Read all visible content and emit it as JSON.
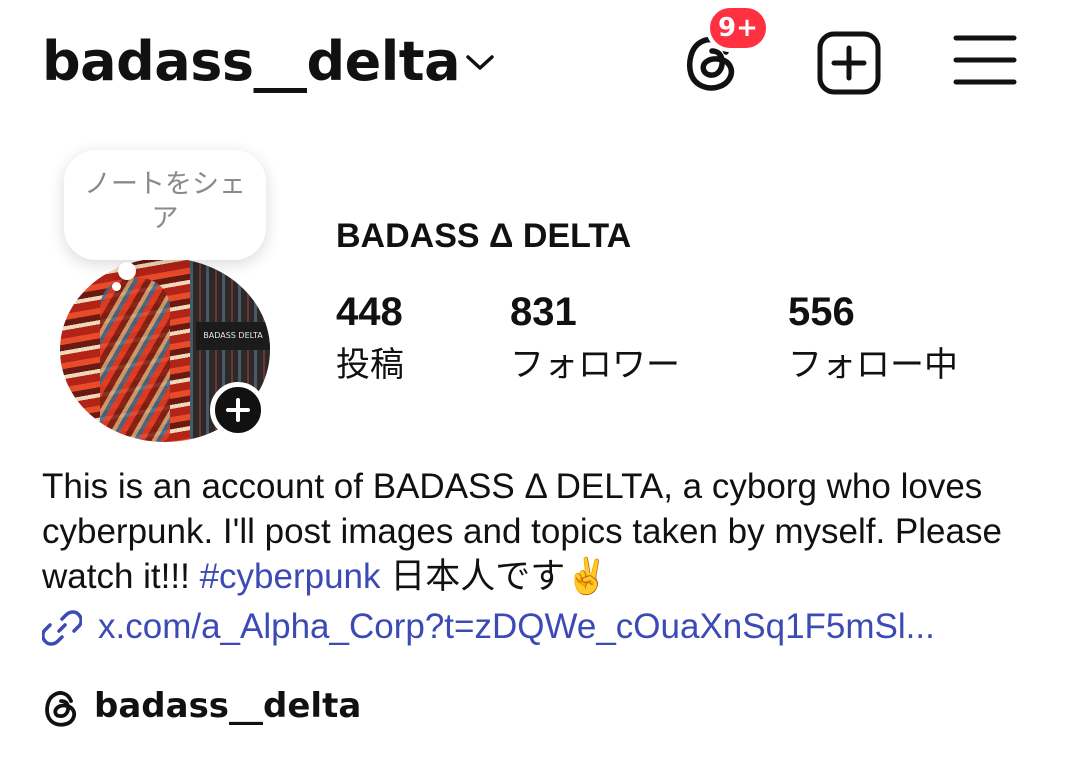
{
  "header": {
    "username": "badass__delta",
    "notification_badge": "9+",
    "badge_color": "#ff3040",
    "icons": [
      "chevron-down-icon",
      "threads-icon",
      "new-post-icon",
      "menu-icon"
    ]
  },
  "note": {
    "text": "ノートをシェア"
  },
  "profile": {
    "display_name": "BADASS Δ DELTA",
    "avatar_caption": "BADASS DELTA",
    "stats": [
      {
        "value": "448",
        "label": "投稿"
      },
      {
        "value": "831",
        "label": "フォロワー"
      },
      {
        "value": "556",
        "label": "フォロー中"
      }
    ]
  },
  "bio": {
    "text_before": "This is an account of BADASS Δ DELTA, a cyborg who loves cyberpunk. I'll post images and topics taken by myself. Please watch it!!! ",
    "hashtag": "#cyberpunk",
    "text_after": " 日本人です✌️",
    "link": "x.com/a_Alpha_Corp?t=zDQWe_cOuaXnSq1F5mSl...",
    "link_color": "#3b4ab5"
  },
  "threads": {
    "handle": "badass__delta"
  }
}
